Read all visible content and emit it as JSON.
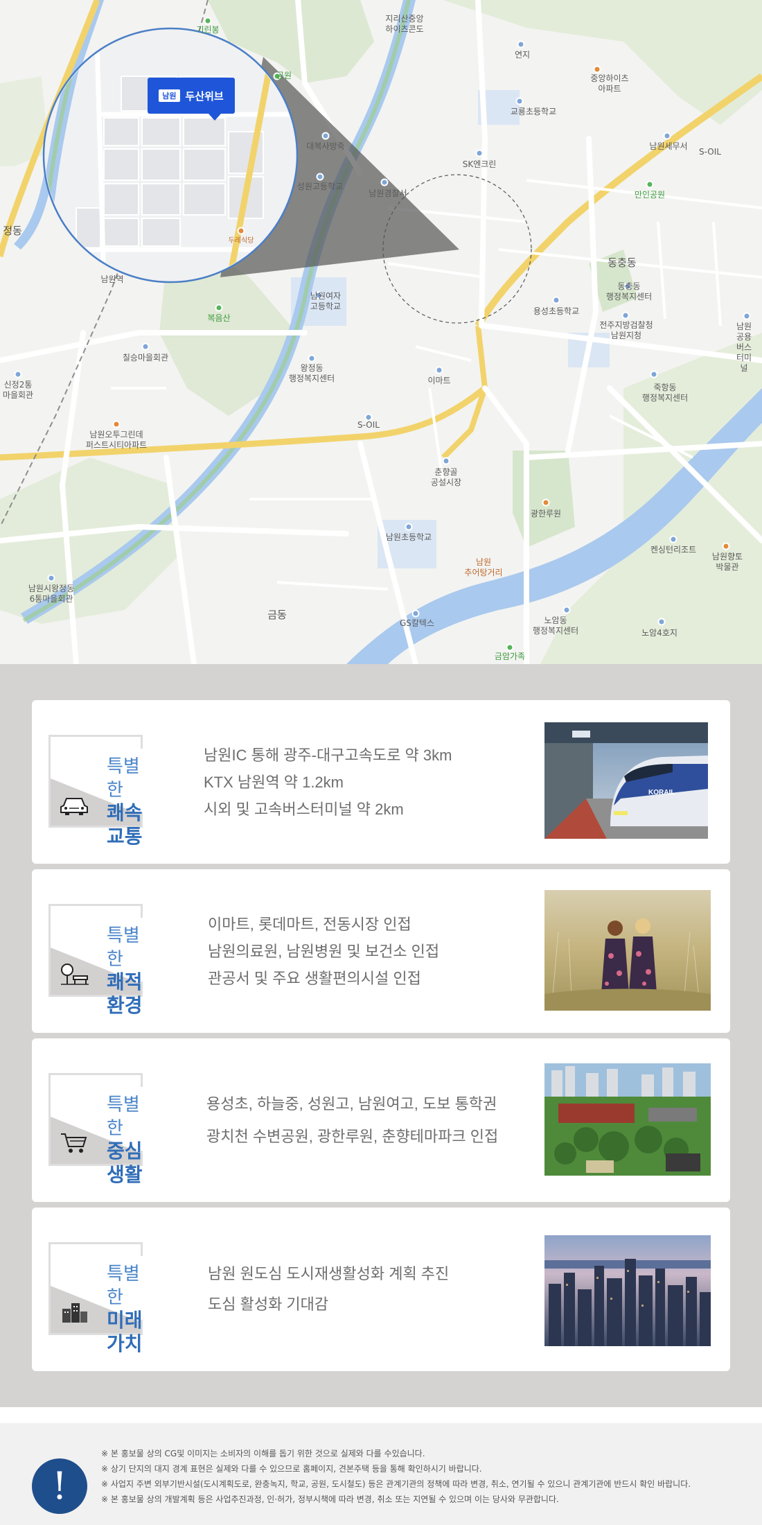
{
  "map": {
    "labels": {
      "girinbong": "기린봉",
      "jirisan_apt": "지리산중앙\n하이츠콘도",
      "yeonji": "연지",
      "jungang_apt": "중앙하이츠\n아파트",
      "gyoryong_school": "교룡초등학교",
      "park_top": "공원",
      "daebuksa": "대복사방죽",
      "sk": "SK엔크린",
      "namwon_tax": "남원세무서",
      "soil_top": "S-OIL",
      "manin_park": "만인공원",
      "seongwon_high": "성원고등학교",
      "police": "남원경찰서",
      "jeong_dong": "정동",
      "dongchung_dong": "동충동",
      "dongchung_center": "동충동\n행정복지센터",
      "yongseong_school": "용성초등학교",
      "prosecutor": "전주지방검찰청\n남원지청",
      "public_bus": "남원공용\n버스터미널",
      "namwon_station": "남원역",
      "girls_high": "남원여자\n고등학교",
      "bokeumsan": "복음산",
      "chilseung": "칠승마을회관",
      "wangjeong_center": "왕정동\n행정복지센터",
      "emart": "이마트",
      "jukhang_center": "죽항동\n행정복지센터",
      "sinjeong": "신정2통\n마을회관",
      "first_city": "남원오투그린데\n퍼스트시티아파트",
      "soil_mid": "S-OIL",
      "chunhyang_market": "춘향골\n공설시장",
      "gwanghallu": "광한루원",
      "namwon_school": "남원초등학교",
      "chueotang": "남원\n추어탕거리",
      "kensington": "켄싱턴리조트",
      "hyangto": "남원향토\n박물관",
      "wangjeong6": "남원시왕정동\n6통마을회관",
      "geum_dong": "금동",
      "gs": "GS칼텍스",
      "noam_center": "노암동\n행정복지센터",
      "noam4": "노암4호지",
      "geumam": "금암가족",
      "restaurant": "두레식당"
    },
    "brand_tag": {
      "badge": "남원",
      "name": "두산위브"
    }
  },
  "features": [
    {
      "title_line1": "특별한",
      "title_line2": "쾌속교통",
      "icon": "car-icon",
      "lines": [
        "남원IC 통해 광주-대구고속도로 약 3km",
        "KTX 남원역 약 1.2km",
        "시외 및 고속버스터미널 약 2km"
      ],
      "photo": "ktx-train-photo",
      "train_logo": "KORAIL"
    },
    {
      "title_line1": "특별한",
      "title_line2": "쾌적환경",
      "icon": "park-bench-icon",
      "lines": [
        "이마트, 롯데마트, 전동시장 인접",
        "남원의료원, 남원병원 및 보건소 인접",
        "관공서 및 주요 생활편의시설 인접"
      ],
      "photo": "children-field-photo"
    },
    {
      "title_line1": "특별한",
      "title_line2": "중심생활",
      "icon": "shopping-cart-icon",
      "lines": [
        "용성초, 하늘중, 성원고, 남원여고, 도보 통학권",
        "광치천 수변공원, 광한루원, 춘향테마파크 인접"
      ],
      "photo": "city-aerial-photo"
    },
    {
      "title_line1": "특별한",
      "title_line2": "미래가치",
      "icon": "buildings-icon",
      "lines": [
        "남원 원도심 도시재생활성화 계획 추진",
        "도심 활성화 기대감"
      ],
      "photo": "skyline-photo"
    }
  ],
  "notice": {
    "symbol": "!",
    "lines": [
      "※ 본 홍보물 상의 CG및 이미지는 소비자의 이해를 돕기 위한 것으로 실제와 다를 수있습니다.",
      "※ 상기 단지의 대지 경계 표현은 실제와 다를 수 있으므로 홈페이지, 견본주택 등을 통해 확인하시기 바랍니다.",
      "※ 사업지 주변 외부기반시설(도시계획도로, 완충녹지, 학교, 공원, 도시철도) 등은 관계기관의 정책에 따라 변경, 취소, 연기될 수 있으니 관계기관에 반드시 확인 바랍니다.",
      "※ 본 홍보물 상의 개발계획 등은 사업추진과정, 인·허가, 정부시책에 따라 변경, 취소 또는 지연될 수 있으며 이는 당사와 무관합니다."
    ]
  },
  "colors": {
    "accent_blue": "#2f6db8",
    "brand_blue": "#1f56d9",
    "panel_gray": "#d5d2d2",
    "notice_blue": "#1f4e8c"
  }
}
